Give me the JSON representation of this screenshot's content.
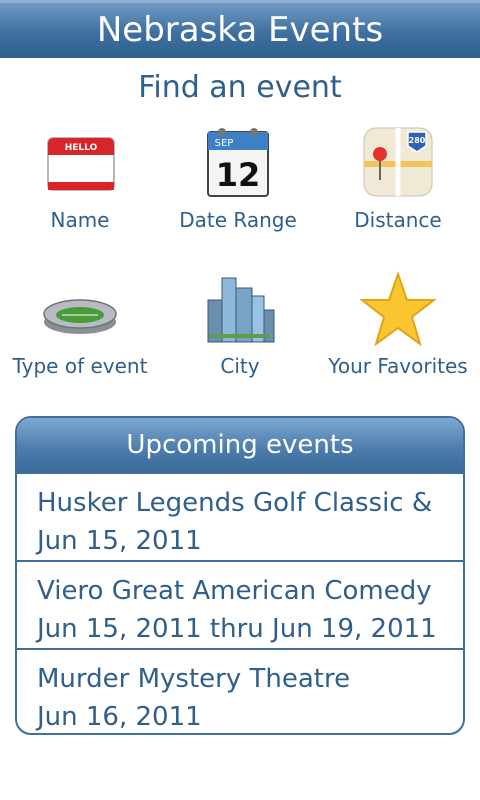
{
  "header": {
    "title": "Nebraska Events"
  },
  "main": {
    "subtitle": "Find an event",
    "tiles": [
      {
        "label": "Name",
        "icon": "hello-name-tag-icon",
        "icon_text": "HELLO"
      },
      {
        "label": "Date Range",
        "icon": "calendar-icon",
        "month": "SEP",
        "day": "12"
      },
      {
        "label": "Distance",
        "icon": "map-pin-icon",
        "road": "280"
      },
      {
        "label": "Type of event",
        "icon": "stadium-icon"
      },
      {
        "label": "City",
        "icon": "city-buildings-icon"
      },
      {
        "label": "Your Favorites",
        "icon": "star-icon"
      }
    ]
  },
  "upcoming": {
    "title": "Upcoming events",
    "events": [
      {
        "name": "Husker Legends Golf Classic &",
        "date": "Jun 15, 2011"
      },
      {
        "name": "Viero Great American Comedy",
        "date": "Jun 15, 2011 thru Jun 19, 2011"
      },
      {
        "name": "Murder Mystery Theatre",
        "date": "Jun 16, 2011"
      }
    ]
  },
  "colors": {
    "brand_blue": "#3e6f9f",
    "text_blue": "#2f5f8a"
  }
}
